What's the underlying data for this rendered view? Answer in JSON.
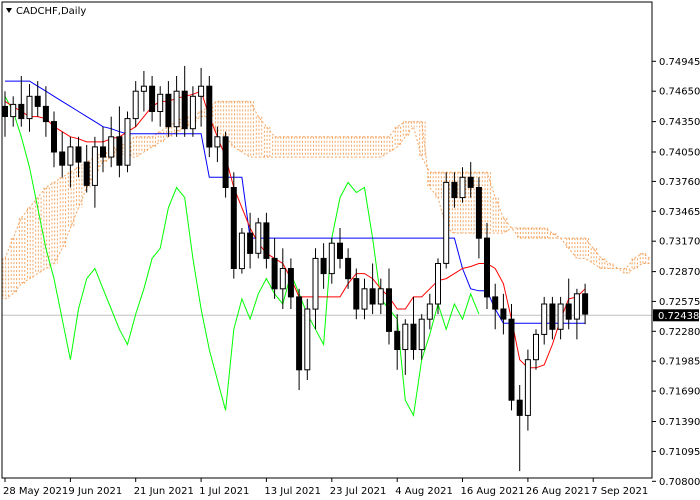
{
  "chart_data": {
    "type": "candlestick",
    "title": "CADCHF,Daily",
    "symbol": "CADCHF",
    "timeframe": "Daily",
    "current_price": "0.72438",
    "ylim": [
      0.707,
      0.751
    ],
    "y_ticks": [
      "0.74945",
      "0.74650",
      "0.74350",
      "0.74050",
      "0.73760",
      "0.73465",
      "0.73170",
      "0.72870",
      "0.72575",
      "0.72280",
      "0.71985",
      "0.71690",
      "0.71390",
      "0.71095",
      "0.70800"
    ],
    "x_ticks": [
      {
        "label": "28 May 2021",
        "index": 0
      },
      {
        "label": "9 Jun 2021",
        "index": 8
      },
      {
        "label": "21 Jun 2021",
        "index": 16
      },
      {
        "label": "1 Jul 2021",
        "index": 24
      },
      {
        "label": "13 Jul 2021",
        "index": 32
      },
      {
        "label": "23 Jul 2021",
        "index": 40
      },
      {
        "label": "4 Aug 2021",
        "index": 48
      },
      {
        "label": "16 Aug 2021",
        "index": 56
      },
      {
        "label": "26 Aug 2021",
        "index": 64
      },
      {
        "label": "7 Sep 2021",
        "index": 72
      }
    ],
    "candles": [
      [
        0.745,
        0.7465,
        0.742,
        0.744
      ],
      [
        0.744,
        0.746,
        0.743,
        0.7452
      ],
      [
        0.7452,
        0.748,
        0.743,
        0.7438
      ],
      [
        0.7438,
        0.7472,
        0.7425,
        0.746
      ],
      [
        0.746,
        0.7475,
        0.744,
        0.745
      ],
      [
        0.745,
        0.747,
        0.742,
        0.7435
      ],
      [
        0.7435,
        0.7445,
        0.739,
        0.7405
      ],
      [
        0.7405,
        0.7425,
        0.738,
        0.7392
      ],
      [
        0.7392,
        0.742,
        0.737,
        0.741
      ],
      [
        0.741,
        0.742,
        0.738,
        0.7395
      ],
      [
        0.7395,
        0.7412,
        0.7365,
        0.7372
      ],
      [
        0.7372,
        0.742,
        0.735,
        0.741
      ],
      [
        0.741,
        0.743,
        0.7385,
        0.74
      ],
      [
        0.74,
        0.744,
        0.739,
        0.742
      ],
      [
        0.742,
        0.745,
        0.738,
        0.7392
      ],
      [
        0.7392,
        0.7445,
        0.7385,
        0.7438
      ],
      [
        0.7438,
        0.7475,
        0.743,
        0.7465
      ],
      [
        0.7465,
        0.7485,
        0.7445,
        0.747
      ],
      [
        0.747,
        0.748,
        0.7435,
        0.7445
      ],
      [
        0.7445,
        0.747,
        0.743,
        0.7462
      ],
      [
        0.7462,
        0.7475,
        0.742,
        0.743
      ],
      [
        0.743,
        0.748,
        0.742,
        0.7465
      ],
      [
        0.7465,
        0.749,
        0.742,
        0.7428
      ],
      [
        0.7428,
        0.747,
        0.742,
        0.746
      ],
      [
        0.746,
        0.7488,
        0.743,
        0.747
      ],
      [
        0.747,
        0.748,
        0.74,
        0.741
      ],
      [
        0.741,
        0.743,
        0.7395,
        0.742
      ],
      [
        0.742,
        0.7425,
        0.736,
        0.737
      ],
      [
        0.737,
        0.7385,
        0.728,
        0.729
      ],
      [
        0.729,
        0.733,
        0.7285,
        0.7325
      ],
      [
        0.7325,
        0.7345,
        0.729,
        0.7305
      ],
      [
        0.7305,
        0.734,
        0.73,
        0.7335
      ],
      [
        0.7335,
        0.7345,
        0.729,
        0.73
      ],
      [
        0.73,
        0.732,
        0.726,
        0.727
      ],
      [
        0.727,
        0.731,
        0.725,
        0.729
      ],
      [
        0.729,
        0.73,
        0.725,
        0.7262
      ],
      [
        0.7262,
        0.727,
        0.717,
        0.719
      ],
      [
        0.719,
        0.726,
        0.718,
        0.725
      ],
      [
        0.725,
        0.731,
        0.723,
        0.73
      ],
      [
        0.73,
        0.7315,
        0.727,
        0.7285
      ],
      [
        0.7285,
        0.732,
        0.7275,
        0.7315
      ],
      [
        0.7315,
        0.733,
        0.729,
        0.73
      ],
      [
        0.73,
        0.731,
        0.727,
        0.728
      ],
      [
        0.728,
        0.729,
        0.724,
        0.725
      ],
      [
        0.725,
        0.728,
        0.724,
        0.727
      ],
      [
        0.727,
        0.7295,
        0.7245,
        0.7255
      ],
      [
        0.7255,
        0.728,
        0.7245,
        0.727
      ],
      [
        0.727,
        0.729,
        0.7215,
        0.7228
      ],
      [
        0.7228,
        0.7245,
        0.719,
        0.721
      ],
      [
        0.721,
        0.724,
        0.7185,
        0.7235
      ],
      [
        0.7235,
        0.7262,
        0.72,
        0.721
      ],
      [
        0.721,
        0.7245,
        0.72,
        0.724
      ],
      [
        0.724,
        0.7265,
        0.723,
        0.7255
      ],
      [
        0.7255,
        0.73,
        0.7245,
        0.7295
      ],
      [
        0.7295,
        0.7385,
        0.729,
        0.7375
      ],
      [
        0.7375,
        0.7385,
        0.735,
        0.736
      ],
      [
        0.736,
        0.739,
        0.7355,
        0.738
      ],
      [
        0.738,
        0.7395,
        0.736,
        0.737
      ],
      [
        0.737,
        0.738,
        0.73,
        0.732
      ],
      [
        0.732,
        0.7335,
        0.725,
        0.7262
      ],
      [
        0.7262,
        0.7275,
        0.723,
        0.725
      ],
      [
        0.725,
        0.7265,
        0.7225,
        0.724
      ],
      [
        0.724,
        0.7255,
        0.715,
        0.716
      ],
      [
        0.716,
        0.7175,
        0.709,
        0.7145
      ],
      [
        0.7145,
        0.721,
        0.713,
        0.72
      ],
      [
        0.72,
        0.723,
        0.719,
        0.7225
      ],
      [
        0.7225,
        0.7262,
        0.7215,
        0.7255
      ],
      [
        0.7255,
        0.7262,
        0.722,
        0.723
      ],
      [
        0.723,
        0.7262,
        0.722,
        0.7255
      ],
      [
        0.7255,
        0.728,
        0.723,
        0.724
      ],
      [
        0.724,
        0.727,
        0.722,
        0.7265
      ],
      [
        0.7265,
        0.7275,
        0.7235,
        0.7245
      ]
    ],
    "tenkan": [
      0.7455,
      0.745,
      0.7445,
      0.744,
      0.744,
      0.7438,
      0.743,
      0.7425,
      0.742,
      0.7418,
      0.7415,
      0.7415,
      0.7415,
      0.7418,
      0.742,
      0.7425,
      0.743,
      0.744,
      0.745,
      0.7455,
      0.7455,
      0.7458,
      0.746,
      0.7462,
      0.7465,
      0.744,
      0.742,
      0.74,
      0.737,
      0.735,
      0.733,
      0.7315,
      0.7305,
      0.73,
      0.7295,
      0.728,
      0.7262,
      0.7262,
      0.7262,
      0.7262,
      0.7262,
      0.7262,
      0.7275,
      0.7285,
      0.7285,
      0.728,
      0.727,
      0.7262,
      0.725,
      0.725,
      0.7262,
      0.7262,
      0.727,
      0.7278,
      0.728,
      0.7285,
      0.729,
      0.7292,
      0.7295,
      0.7295,
      0.729,
      0.7275,
      0.724,
      0.72,
      0.7192,
      0.7192,
      0.7195,
      0.7215,
      0.724,
      0.726,
      0.7262,
      0.727
    ],
    "kijun": [
      0.7475,
      0.7475,
      0.7475,
      0.7475,
      0.747,
      0.7465,
      0.746,
      0.7455,
      0.745,
      0.7445,
      0.744,
      0.7435,
      0.743,
      0.7428,
      0.7425,
      0.7423,
      0.7423,
      0.7423,
      0.7423,
      0.7423,
      0.7423,
      0.7423,
      0.7423,
      0.7423,
      0.7423,
      0.738,
      0.738,
      0.738,
      0.738,
      0.738,
      0.732,
      0.732,
      0.732,
      0.732,
      0.732,
      0.732,
      0.732,
      0.732,
      0.732,
      0.732,
      0.732,
      0.732,
      0.732,
      0.732,
      0.732,
      0.732,
      0.732,
      0.732,
      0.732,
      0.732,
      0.732,
      0.732,
      0.732,
      0.732,
      0.732,
      0.732,
      0.729,
      0.727,
      0.7268,
      0.7268,
      0.725,
      0.7236,
      0.7236,
      0.7236,
      0.7236,
      0.7236,
      0.7236,
      0.7236,
      0.7236,
      0.7236,
      0.7236,
      0.7236
    ],
    "chikou": [
      0.746,
      0.7445,
      0.742,
      0.739,
      0.735,
      0.731,
      0.728,
      0.724,
      0.72,
      0.725,
      0.728,
      0.729,
      0.727,
      0.725,
      0.723,
      0.7215,
      0.7245,
      0.727,
      0.73,
      0.731,
      0.735,
      0.737,
      0.736,
      0.73,
      0.725,
      0.721,
      0.718,
      0.715,
      0.723,
      0.726,
      0.724,
      0.7265,
      0.728,
      0.7265,
      0.7255,
      0.7285,
      0.7265,
      0.7245,
      0.723,
      0.7215,
      0.732,
      0.736,
      0.7375,
      0.7365,
      0.737,
      0.732,
      0.726,
      0.725,
      0.724,
      0.716,
      0.7145,
      0.72,
      0.7225,
      0.7255,
      0.723,
      0.7255,
      0.724,
      0.7265,
      0.7245
    ],
    "span_a": [
      0.73,
      0.732,
      0.734,
      0.735,
      0.736,
      0.737,
      0.7375,
      0.738,
      0.7385,
      0.739,
      0.7395,
      0.74,
      0.7405,
      0.741,
      0.7405,
      0.74,
      0.74,
      0.7405,
      0.741,
      0.7415,
      0.742,
      0.7425,
      0.743,
      0.7435,
      0.744,
      0.744,
      0.7425,
      0.742,
      0.741,
      0.7405,
      0.74,
      0.74,
      0.74,
      0.74,
      0.74,
      0.74,
      0.74,
      0.74,
      0.74,
      0.74,
      0.74,
      0.74,
      0.74,
      0.74,
      0.74,
      0.74,
      0.74,
      0.7405,
      0.741,
      0.742,
      0.743,
      0.74,
      0.7385,
      0.7385,
      0.7385,
      0.7385,
      0.7385,
      0.7385,
      0.7385,
      0.7385,
      0.736,
      0.734,
      0.733,
      0.732,
      0.732,
      0.732,
      0.732,
      0.732,
      0.732,
      0.732,
      0.732,
      0.732,
      0.731,
      0.73,
      0.7295,
      0.729,
      0.729,
      0.73,
      0.7305,
      0.73
    ],
    "span_b": [
      0.726,
      0.7265,
      0.7275,
      0.728,
      0.7285,
      0.729,
      0.7295,
      0.731,
      0.733,
      0.735,
      0.737,
      0.7385,
      0.7395,
      0.74,
      0.741,
      0.7415,
      0.742,
      0.742,
      0.742,
      0.7425,
      0.743,
      0.7435,
      0.744,
      0.744,
      0.7445,
      0.745,
      0.7455,
      0.7455,
      0.7455,
      0.7455,
      0.7455,
      0.744,
      0.743,
      0.742,
      0.742,
      0.742,
      0.742,
      0.742,
      0.742,
      0.742,
      0.742,
      0.742,
      0.742,
      0.742,
      0.742,
      0.742,
      0.742,
      0.742,
      0.743,
      0.7435,
      0.7435,
      0.7435,
      0.737,
      0.736,
      0.733,
      0.7325,
      0.7325,
      0.7325,
      0.7325,
      0.7325,
      0.7325,
      0.7325,
      0.733,
      0.733,
      0.733,
      0.733,
      0.733,
      0.7325,
      0.732,
      0.731,
      0.73,
      0.73,
      0.7295,
      0.729,
      0.729,
      0.729,
      0.7285,
      0.729,
      0.7295,
      0.7295
    ],
    "colors": {
      "background": "#ffffff",
      "bull": "#ffffff",
      "bear": "#000000",
      "outline": "#000000",
      "tenkan": "#ff0000",
      "kijun": "#0000ff",
      "chikou": "#00ff00",
      "cloud": "#f4a460",
      "price_line": "#c0c0c0",
      "price_label_bg": "#000000",
      "price_label_text": "#ffffff"
    }
  }
}
